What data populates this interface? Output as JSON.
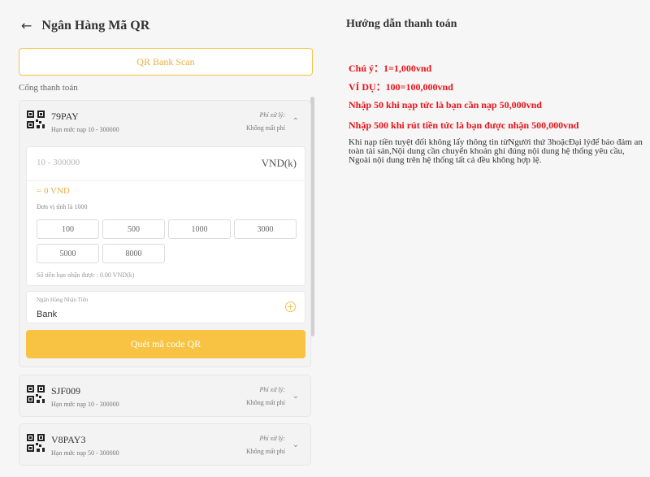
{
  "header": {
    "title": "Ngân Hàng Mã QR"
  },
  "scan_button": "QR Bank Scan",
  "section_label": "Cổng thanh toán",
  "gateways": [
    {
      "name": "79PAY",
      "limit": "Hạn mức nạp 10 - 300000",
      "fee_label": "Phí xử lý:",
      "fee_value": "Không mất phí",
      "expanded": true,
      "amount_placeholder": "10 - 300000",
      "unit": "VND(k)",
      "result": "= 0 VND",
      "unit_note": "Đơn vị tính là 1000",
      "presets": [
        "100",
        "500",
        "1000",
        "3000",
        "5000",
        "8000"
      ],
      "receive_note": "Số tiền bạn nhận được : 0.00 VND(k)",
      "bank_label": "Ngân Hàng Nhận Tiền",
      "bank_value": "Bank",
      "qr_button": "Quét mã code QR"
    },
    {
      "name": "SJF009",
      "limit": "Hạn mức nạp 10 - 300000",
      "fee_label": "Phí xử lý:",
      "fee_value": "Không mất phí",
      "expanded": false
    },
    {
      "name": "V8PAY3",
      "limit": "Hạn mức nạp 50 - 300000",
      "fee_label": "Phí xử lý:",
      "fee_value": "Không mất phí",
      "expanded": false
    }
  ],
  "guide": {
    "title": "Hướng dẫn thanh toán",
    "notes": [
      "Chú ý：1=1,000vnd",
      "VÍ DỤ：100=100,000vnd",
      "Nhập 50 khi nạp tức là bạn cần nạp 50,000vnd",
      "Nhập 500 khi rút tiền tức là bạn được nhận 500,000vnd"
    ],
    "body": "Khi nạp tiền tuyệt đối không lấy thông tin từNgười thứ 3hoặcĐại lýđể bảo đảm an toàn tài sản,Nội dung cần chuyển khoản ghi đúng nội dung hệ thống yêu cầu, Ngoài nội dung trên hệ thống tất cả đều không hợp lệ."
  },
  "colors": {
    "accent": "#f8c342",
    "warning": "#e8141a"
  },
  "icons": {
    "back": "back-arrow-icon",
    "gateway": "qr-code-icon",
    "expand": "chevron-icon",
    "add": "plus-circle-icon"
  }
}
